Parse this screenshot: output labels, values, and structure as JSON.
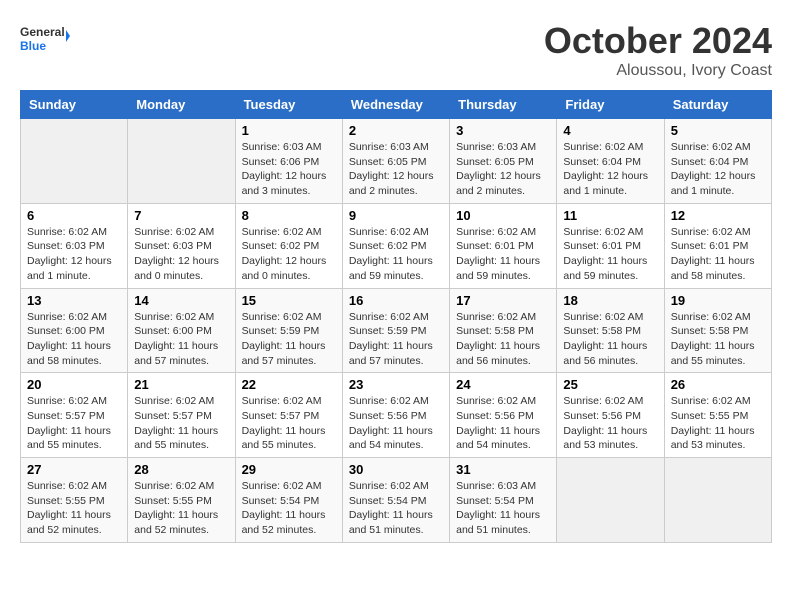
{
  "logo": {
    "text_general": "General",
    "text_blue": "Blue"
  },
  "title": "October 2024",
  "location": "Aloussou, Ivory Coast",
  "weekdays": [
    "Sunday",
    "Monday",
    "Tuesday",
    "Wednesday",
    "Thursday",
    "Friday",
    "Saturday"
  ],
  "weeks": [
    [
      {
        "day": "",
        "info": ""
      },
      {
        "day": "",
        "info": ""
      },
      {
        "day": "1",
        "info": "Sunrise: 6:03 AM\nSunset: 6:06 PM\nDaylight: 12 hours and 3 minutes."
      },
      {
        "day": "2",
        "info": "Sunrise: 6:03 AM\nSunset: 6:05 PM\nDaylight: 12 hours and 2 minutes."
      },
      {
        "day": "3",
        "info": "Sunrise: 6:03 AM\nSunset: 6:05 PM\nDaylight: 12 hours and 2 minutes."
      },
      {
        "day": "4",
        "info": "Sunrise: 6:02 AM\nSunset: 6:04 PM\nDaylight: 12 hours and 1 minute."
      },
      {
        "day": "5",
        "info": "Sunrise: 6:02 AM\nSunset: 6:04 PM\nDaylight: 12 hours and 1 minute."
      }
    ],
    [
      {
        "day": "6",
        "info": "Sunrise: 6:02 AM\nSunset: 6:03 PM\nDaylight: 12 hours and 1 minute."
      },
      {
        "day": "7",
        "info": "Sunrise: 6:02 AM\nSunset: 6:03 PM\nDaylight: 12 hours and 0 minutes."
      },
      {
        "day": "8",
        "info": "Sunrise: 6:02 AM\nSunset: 6:02 PM\nDaylight: 12 hours and 0 minutes."
      },
      {
        "day": "9",
        "info": "Sunrise: 6:02 AM\nSunset: 6:02 PM\nDaylight: 11 hours and 59 minutes."
      },
      {
        "day": "10",
        "info": "Sunrise: 6:02 AM\nSunset: 6:01 PM\nDaylight: 11 hours and 59 minutes."
      },
      {
        "day": "11",
        "info": "Sunrise: 6:02 AM\nSunset: 6:01 PM\nDaylight: 11 hours and 59 minutes."
      },
      {
        "day": "12",
        "info": "Sunrise: 6:02 AM\nSunset: 6:01 PM\nDaylight: 11 hours and 58 minutes."
      }
    ],
    [
      {
        "day": "13",
        "info": "Sunrise: 6:02 AM\nSunset: 6:00 PM\nDaylight: 11 hours and 58 minutes."
      },
      {
        "day": "14",
        "info": "Sunrise: 6:02 AM\nSunset: 6:00 PM\nDaylight: 11 hours and 57 minutes."
      },
      {
        "day": "15",
        "info": "Sunrise: 6:02 AM\nSunset: 5:59 PM\nDaylight: 11 hours and 57 minutes."
      },
      {
        "day": "16",
        "info": "Sunrise: 6:02 AM\nSunset: 5:59 PM\nDaylight: 11 hours and 57 minutes."
      },
      {
        "day": "17",
        "info": "Sunrise: 6:02 AM\nSunset: 5:58 PM\nDaylight: 11 hours and 56 minutes."
      },
      {
        "day": "18",
        "info": "Sunrise: 6:02 AM\nSunset: 5:58 PM\nDaylight: 11 hours and 56 minutes."
      },
      {
        "day": "19",
        "info": "Sunrise: 6:02 AM\nSunset: 5:58 PM\nDaylight: 11 hours and 55 minutes."
      }
    ],
    [
      {
        "day": "20",
        "info": "Sunrise: 6:02 AM\nSunset: 5:57 PM\nDaylight: 11 hours and 55 minutes."
      },
      {
        "day": "21",
        "info": "Sunrise: 6:02 AM\nSunset: 5:57 PM\nDaylight: 11 hours and 55 minutes."
      },
      {
        "day": "22",
        "info": "Sunrise: 6:02 AM\nSunset: 5:57 PM\nDaylight: 11 hours and 55 minutes."
      },
      {
        "day": "23",
        "info": "Sunrise: 6:02 AM\nSunset: 5:56 PM\nDaylight: 11 hours and 54 minutes."
      },
      {
        "day": "24",
        "info": "Sunrise: 6:02 AM\nSunset: 5:56 PM\nDaylight: 11 hours and 54 minutes."
      },
      {
        "day": "25",
        "info": "Sunrise: 6:02 AM\nSunset: 5:56 PM\nDaylight: 11 hours and 53 minutes."
      },
      {
        "day": "26",
        "info": "Sunrise: 6:02 AM\nSunset: 5:55 PM\nDaylight: 11 hours and 53 minutes."
      }
    ],
    [
      {
        "day": "27",
        "info": "Sunrise: 6:02 AM\nSunset: 5:55 PM\nDaylight: 11 hours and 52 minutes."
      },
      {
        "day": "28",
        "info": "Sunrise: 6:02 AM\nSunset: 5:55 PM\nDaylight: 11 hours and 52 minutes."
      },
      {
        "day": "29",
        "info": "Sunrise: 6:02 AM\nSunset: 5:54 PM\nDaylight: 11 hours and 52 minutes."
      },
      {
        "day": "30",
        "info": "Sunrise: 6:02 AM\nSunset: 5:54 PM\nDaylight: 11 hours and 51 minutes."
      },
      {
        "day": "31",
        "info": "Sunrise: 6:03 AM\nSunset: 5:54 PM\nDaylight: 11 hours and 51 minutes."
      },
      {
        "day": "",
        "info": ""
      },
      {
        "day": "",
        "info": ""
      }
    ]
  ]
}
